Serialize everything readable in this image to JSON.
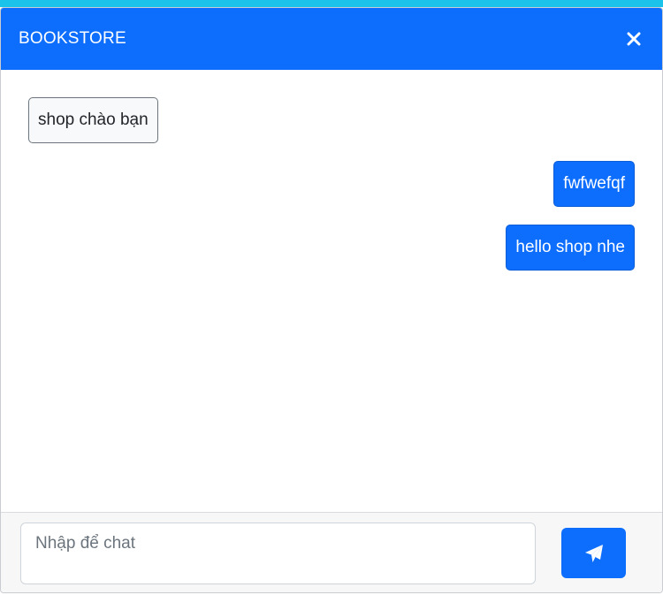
{
  "header": {
    "title": "BOOKSTORE",
    "close_icon": "close-icon"
  },
  "messages": [
    {
      "from": "shop",
      "text": "shop chào bạn"
    },
    {
      "from": "user",
      "text": "fwfwefqf"
    },
    {
      "from": "user",
      "text": "hello shop nhe"
    }
  ],
  "composer": {
    "placeholder": "Nhập để chat",
    "value": "",
    "send_icon": "paper-plane-icon"
  },
  "colors": {
    "primary": "#0d6efd",
    "top_strip": "#1bc3ea",
    "footer_bg": "#f7f7f7"
  }
}
